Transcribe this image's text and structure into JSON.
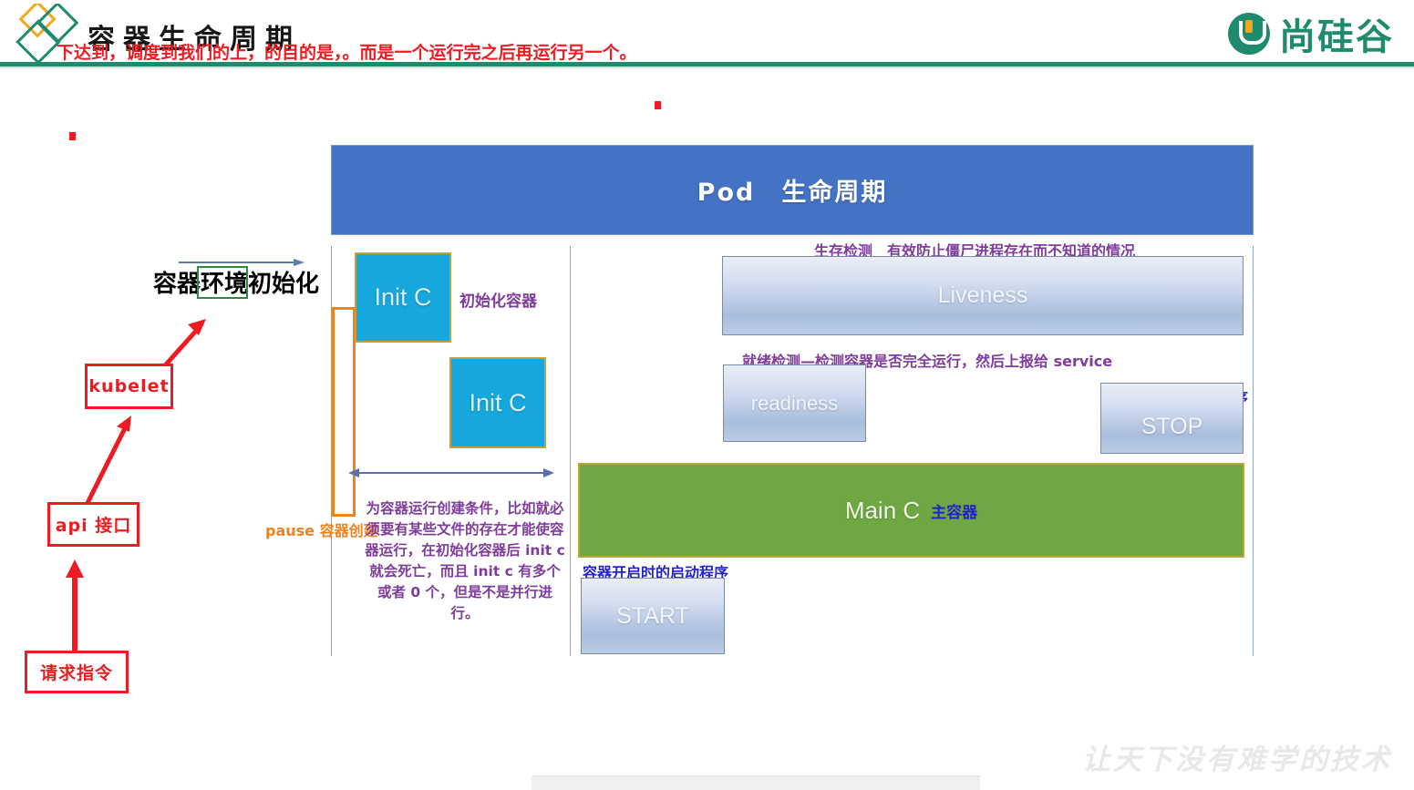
{
  "header": {
    "slide_title": "容器生命周期",
    "red_annotation": "下达到，调度到我们的上，的目的是，。而是一个运行完之后再运行另一个。",
    "brand_name": "尚硅谷",
    "brand_icon": "u-logo-icon"
  },
  "diagram": {
    "banner_title": "Pod　生命周期",
    "env_init_label": "容器环境初始化",
    "init_containers": [
      {
        "label": "Init C"
      },
      {
        "label": "Init C"
      }
    ],
    "init_container_note": "初始化容器",
    "pause_label": "pause 容器创建",
    "pause_paragraph": "为容器运行创建条件，比如就必须要有某些文件的存在才能使容器运行，在初始化容器后 init c 就会死亡，而且 init c 有多个或者 0 个，但是不是并行进行。",
    "liveness": {
      "label": "Liveness",
      "note": "生存检测　有效防止僵尸进程存在而不知道的情况"
    },
    "readiness": {
      "label": "readiness",
      "note": "就绪检测—检测容器是否完全运行，然后上报给 service"
    },
    "stop": {
      "label": "STOP",
      "note": "容器停止时的遗嘱程序"
    },
    "start": {
      "label": "START",
      "note": "容器开启时的启动程序"
    },
    "main_container": {
      "label": "Main C",
      "note": "主容器"
    }
  },
  "left_flow": {
    "nodes": [
      {
        "label": "kubelet"
      },
      {
        "label": "api 接口"
      },
      {
        "label": "请求指令"
      }
    ]
  },
  "footer": {
    "watermark": "让天下没有难学的技术"
  },
  "colors": {
    "brand_green": "#1E8A6E",
    "banner_blue": "#4472C4",
    "init_cyan": "#16A7DC",
    "main_green": "#6FA843",
    "annotation_red": "#EE1C22",
    "annotation_purple": "#7E3C9B",
    "annotation_blue": "#2222CC",
    "pause_orange": "#F0821E"
  }
}
